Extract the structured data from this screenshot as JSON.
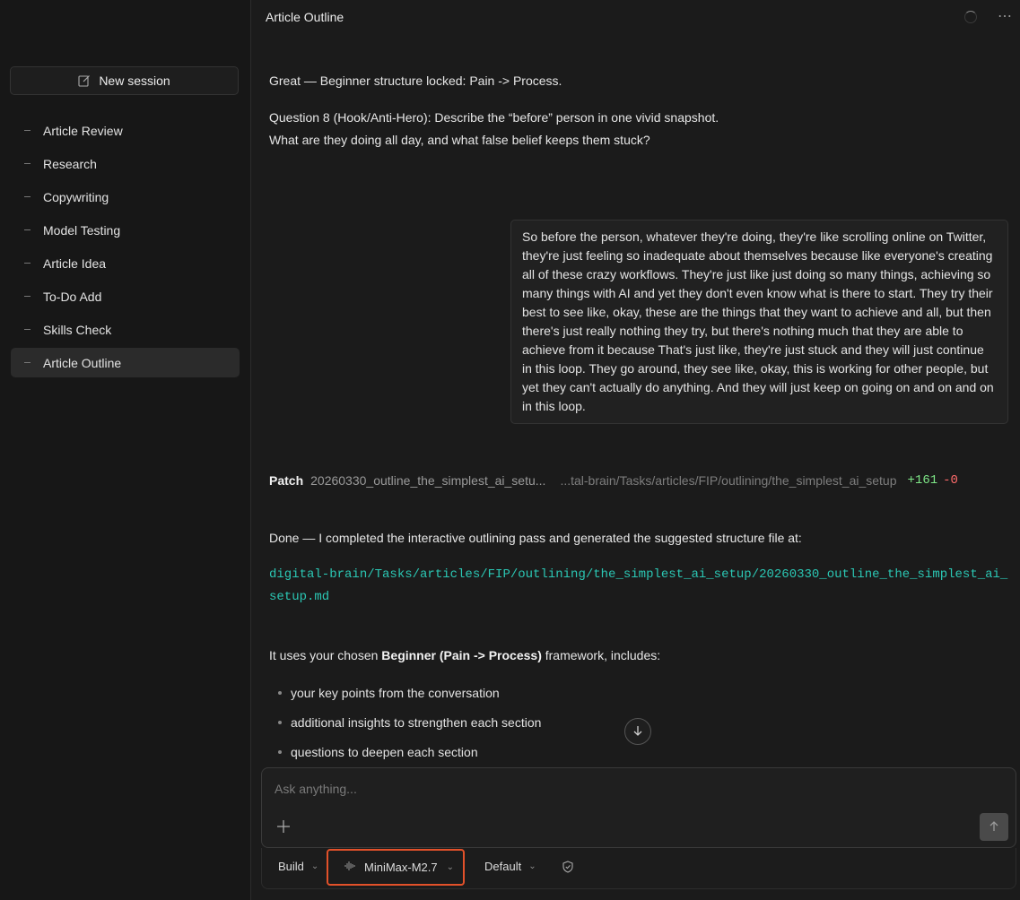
{
  "sidebar": {
    "new_session_label": "New session",
    "items": [
      {
        "label": "Article Review"
      },
      {
        "label": "Research"
      },
      {
        "label": "Copywriting"
      },
      {
        "label": "Model Testing"
      },
      {
        "label": "Article Idea"
      },
      {
        "label": "To-Do Add"
      },
      {
        "label": "Skills Check"
      },
      {
        "label": "Article Outline",
        "active": true
      }
    ]
  },
  "header": {
    "title": "Article Outline",
    "more_icon": "ellipsis-icon"
  },
  "conversation": {
    "assistant_1": {
      "line1": "Great — Beginner structure locked: Pain -> Process.",
      "line2": "Question 8 (Hook/Anti-Hero): Describe the “before” person in one vivid snapshot.",
      "line3": "What are they doing all day, and what false belief keeps them stuck?"
    },
    "user_1": "So before the person, whatever they're doing, they're like scrolling online on Twitter, they're just feeling so inadequate about themselves because like everyone's creating all of these crazy workflows. They're just like just doing so many things, achieving so many things with AI and yet they don't even know what is there to start. They try their best to see like, okay, these are the things that they want to achieve and all, but then there's just really nothing they try, but there's nothing much that they are able to achieve from it because That's just like, they're just stuck and they will just continue in this loop. They go around, they see like, okay, this is working for other people, but yet they can't actually do anything. And they will just keep on going on and on and on in this loop.",
    "patch": {
      "label": "Patch",
      "file": "20260330_outline_the_simplest_ai_setu...",
      "path": "...tal-brain/Tasks/articles/FIP/outlining/the_simplest_ai_setup",
      "additions": "+161",
      "deletions": "-0"
    },
    "assistant_2": {
      "done_line": "Done — I completed the interactive outlining pass and generated the suggested structure file at:",
      "file_path": "digital-brain/Tasks/articles/FIP/outlining/the_simplest_ai_setup/20260330_outline_the_simplest_ai_setup.md",
      "uses_prefix": "It uses your chosen ",
      "uses_bold": "Beginner (Pain -> Process)",
      "uses_suffix": " framework, includes:",
      "bullets": [
        "your key points from the conversation",
        "additional insights to strengthen each section",
        "questions to deepen each section"
      ]
    }
  },
  "composer": {
    "placeholder": "Ask anything...",
    "mode": "Build",
    "model": "MiniMax-M2.7",
    "profile": "Default",
    "highlight_color": "#e2512a"
  }
}
